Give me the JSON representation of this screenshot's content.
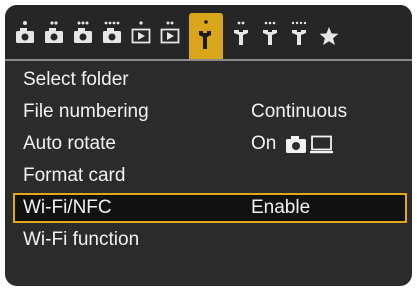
{
  "tabs": [
    {
      "icon": "shooting-tab-icon",
      "active": false
    },
    {
      "icon": "shooting-tab-icon",
      "active": false
    },
    {
      "icon": "shooting-tab-icon",
      "active": false
    },
    {
      "icon": "shooting-tab-icon",
      "active": false
    },
    {
      "icon": "playback-tab-icon",
      "active": false
    },
    {
      "icon": "playback-tab-icon",
      "active": false
    },
    {
      "icon": "setup-tab-icon",
      "active": true
    },
    {
      "icon": "setup-tab-icon",
      "active": false
    },
    {
      "icon": "setup-tab-icon",
      "active": false
    },
    {
      "icon": "setup-tab-icon",
      "active": false
    },
    {
      "icon": "my-menu-star-icon",
      "active": false
    }
  ],
  "menu": {
    "items": [
      {
        "label": "Select folder",
        "value": ""
      },
      {
        "label": "File numbering",
        "value": "Continuous"
      },
      {
        "label": "Auto rotate",
        "value": "On",
        "value_icons": [
          "camera-icon",
          "computer-monitor-icon"
        ]
      },
      {
        "label": "Format card",
        "value": ""
      },
      {
        "label": "Wi-Fi/NFC",
        "value": "Enable",
        "selected": true
      },
      {
        "label": "Wi-Fi function",
        "value": ""
      }
    ]
  },
  "colors": {
    "screen_bg": "#2b2b2b",
    "highlight": "#e0a81c",
    "active_tab": "#d9a51a",
    "text": "#f2f2f2"
  }
}
